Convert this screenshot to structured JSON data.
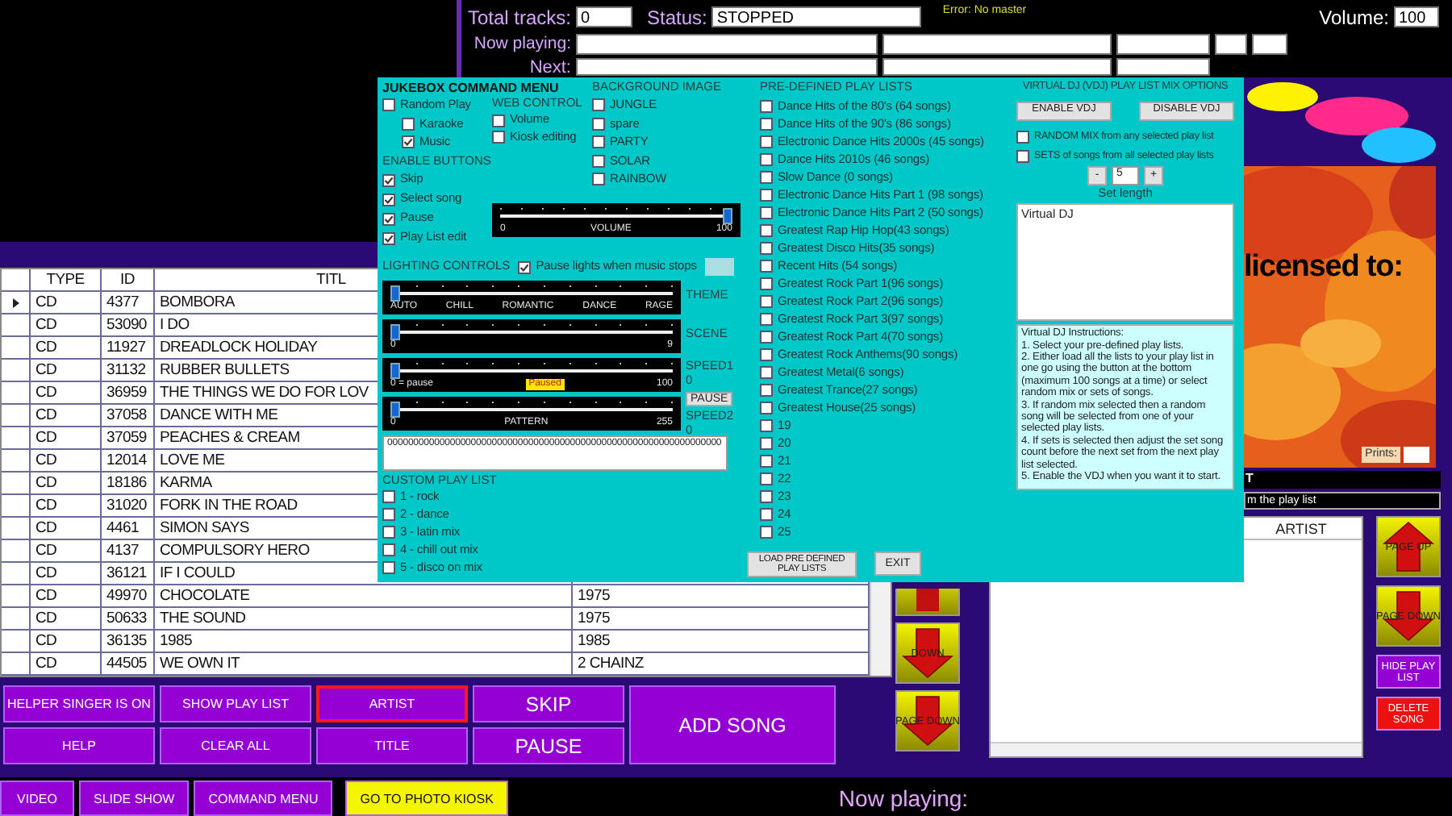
{
  "header": {
    "total_tracks_label": "Total tracks:",
    "total_tracks": "0",
    "status_label": "Status:",
    "status": "STOPPED",
    "error": "Error: No master",
    "volume_label": "Volume:",
    "volume": "100",
    "now_playing_label": "Now playing:",
    "next_label": "Next:"
  },
  "tracks_table": {
    "columns": [
      "TYPE",
      "ID",
      "TITL"
    ],
    "rows": [
      {
        "type": "CD",
        "id": "4377",
        "title": "BOMBORA",
        "selected": true
      },
      {
        "type": "CD",
        "id": "53090",
        "title": "I DO",
        "selected": false
      },
      {
        "type": "CD",
        "id": "11927",
        "title": "DREADLOCK HOLIDAY",
        "selected": false
      },
      {
        "type": "CD",
        "id": "31132",
        "title": "RUBBER BULLETS",
        "selected": false
      },
      {
        "type": "CD",
        "id": "36959",
        "title": "THE THINGS WE DO FOR LOV",
        "selected": false
      },
      {
        "type": "CD",
        "id": "37058",
        "title": "DANCE WITH ME",
        "selected": false
      },
      {
        "type": "CD",
        "id": "37059",
        "title": "PEACHES & CREAM",
        "selected": false
      },
      {
        "type": "CD",
        "id": "12014",
        "title": "LOVE ME",
        "selected": false
      },
      {
        "type": "CD",
        "id": "18186",
        "title": "KARMA",
        "selected": false
      },
      {
        "type": "CD",
        "id": "31020",
        "title": "FORK IN THE ROAD",
        "selected": false
      },
      {
        "type": "CD",
        "id": "4461",
        "title": "SIMON SAYS",
        "selected": false
      },
      {
        "type": "CD",
        "id": "4137",
        "title": "COMPULSORY HERO",
        "selected": false
      },
      {
        "type": "CD",
        "id": "36121",
        "title": "IF I COULD",
        "selected": false
      },
      {
        "type": "CD",
        "id": "49970",
        "title": "CHOCOLATE",
        "column_4": "1975",
        "selected": false
      },
      {
        "type": "CD",
        "id": "50633",
        "title": "THE SOUND",
        "column_4": "1975",
        "selected": false
      },
      {
        "type": "CD",
        "id": "36135",
        "title": "1985",
        "column_4": "1985",
        "selected": false
      },
      {
        "type": "CD",
        "id": "44505",
        "title": "WE OWN IT",
        "column_4": "2 CHAINZ",
        "selected": false
      }
    ]
  },
  "control_buttons": [
    {
      "label": "HELPER SINGER IS ON",
      "kind": "small",
      "selected": false
    },
    {
      "label": "SHOW PLAY LIST",
      "kind": "small",
      "selected": false
    },
    {
      "label": "ARTIST",
      "kind": "small",
      "selected": true
    },
    {
      "label": "SKIP",
      "kind": "large",
      "selected": false
    },
    {
      "label": "ADD SONG",
      "kind": "tall",
      "selected": false
    },
    {
      "label": "HELP",
      "kind": "small",
      "selected": false
    },
    {
      "label": "CLEAR ALL",
      "kind": "small",
      "selected": false
    },
    {
      "label": "TITLE",
      "kind": "small",
      "selected": false
    },
    {
      "label": "PAUSE",
      "kind": "large",
      "selected": false
    }
  ],
  "nav_buttons": [
    {
      "kind": "stub"
    },
    {
      "label": "DOWN",
      "kind": "down"
    },
    {
      "label": "PAGE DOWN",
      "kind": "down"
    }
  ],
  "preview": {
    "caption": "licensed to:",
    "prints_label": "Prints:"
  },
  "playlist_panel": {
    "title": "T",
    "hint": "m the play list",
    "columns": [
      "ARTIST"
    ]
  },
  "playlist_buttons": [
    {
      "label": "PAGE UP",
      "kind": "up"
    },
    {
      "label": "PAGE DOWN",
      "kind": "down"
    },
    {
      "label": "HIDE PLAY LIST",
      "kind": "menu"
    },
    {
      "label": "DELETE SONG",
      "kind": "danger"
    }
  ],
  "bottom_bar": {
    "buttons": [
      {
        "label": "VIDEO",
        "kind": "menu"
      },
      {
        "label": "SLIDE SHOW",
        "kind": "menu"
      },
      {
        "label": "COMMAND MENU",
        "kind": "menu"
      },
      {
        "label": "GO TO  PHOTO KIOSK",
        "kind": "highlight"
      }
    ],
    "now_playing_label": "Now playing:"
  },
  "command_menu": {
    "title": "JUKEBOX COMMAND MENU",
    "play_mode": [
      {
        "label": "Random Play",
        "checked": false,
        "children": [
          {
            "label": "Karaoke",
            "checked": false
          },
          {
            "label": "Music",
            "checked": true
          }
        ]
      }
    ],
    "web_control": {
      "title": "WEB CONTROL",
      "options": [
        {
          "label": "Volume",
          "checked": false
        },
        {
          "label": "Kiosk editing",
          "checked": false
        }
      ]
    },
    "background_image": {
      "title": "BACKGROUND IMAGE",
      "options": [
        {
          "label": "JUNGLE",
          "checked": false
        },
        {
          "label": "spare",
          "checked": false
        },
        {
          "label": "PARTY",
          "checked": false
        },
        {
          "label": "SOLAR",
          "checked": false
        },
        {
          "label": "RAINBOW",
          "checked": false
        }
      ]
    },
    "enable_buttons": {
      "title": "ENABLE BUTTONS",
      "options": [
        {
          "label": "Skip",
          "checked": true
        },
        {
          "label": "Select song",
          "checked": true
        },
        {
          "label": "Pause",
          "checked": true
        },
        {
          "label": "Play List edit",
          "checked": true
        }
      ]
    },
    "volume_slider": {
      "labels": [
        {
          "text": "0",
          "kind": "tick"
        },
        {
          "text": "VOLUME",
          "kind": "tick"
        },
        {
          "text": "100",
          "kind": "tick"
        }
      ],
      "level": 1
    },
    "lighting": {
      "title": "LIGHTING CONTROLS",
      "pause_lights": {
        "label": "Pause lights when music stops",
        "checked": true
      },
      "sliders": [
        {
          "name": "THEME",
          "labels": [
            {
              "text": "AUTO",
              "kind": "tick"
            },
            {
              "text": "CHILL",
              "kind": "tick"
            },
            {
              "text": "ROMANTIC",
              "kind": "tick"
            },
            {
              "text": "DANCE",
              "kind": "tick"
            },
            {
              "text": "RAGE",
              "kind": "tick"
            }
          ],
          "level": 0
        },
        {
          "name": "SCENE",
          "labels": [
            {
              "text": "0",
              "kind": "tick"
            },
            {
              "text": "9",
              "kind": "tick"
            }
          ],
          "level": 0
        },
        {
          "name": "SPEED1",
          "value": "0",
          "button": "PAUSE",
          "labels": [
            {
              "text": "0 = pause",
              "kind": "tick"
            },
            {
              "text": "Paused",
              "kind": "badge"
            },
            {
              "text": "100",
              "kind": "tick"
            }
          ],
          "level": 0
        },
        {
          "name": "SPEED2",
          "value": "0",
          "labels": [
            {
              "text": "0",
              "kind": "tick"
            },
            {
              "text": "PATTERN",
              "kind": "tick"
            },
            {
              "text": "255",
              "kind": "tick"
            }
          ],
          "level": 0
        }
      ],
      "pattern": "0000000000000000000000000000000000000000000000000000000000000000"
    },
    "custom_play_list": {
      "title": "CUSTOM PLAY LIST",
      "options": [
        {
          "label": "1 - rock",
          "checked": false
        },
        {
          "label": "2 - dance",
          "checked": false
        },
        {
          "label": "3 - latin mix",
          "checked": false
        },
        {
          "label": "4 - chill out mix",
          "checked": false
        },
        {
          "label": "5 - disco on mix",
          "checked": false
        }
      ]
    },
    "predefined": {
      "title": "PRE-DEFINED PLAY LISTS",
      "options": [
        {
          "label": "Dance Hits of the 80's (64 songs)",
          "checked": false
        },
        {
          "label": "Dance Hits of the 90's (86 songs)",
          "checked": false
        },
        {
          "label": "Electronic Dance Hits 2000s (45 songs)",
          "checked": false
        },
        {
          "label": "Dance Hits 2010s (46 songs)",
          "checked": false
        },
        {
          "label": "Slow Dance (0 songs)",
          "checked": false
        },
        {
          "label": "Electronic Dance Hits Part 1 (98 songs)",
          "checked": false
        },
        {
          "label": "Electronic Dance Hits Part 2 (50 songs)",
          "checked": false
        },
        {
          "label": "Greatest Rap Hip Hop(43 songs)",
          "checked": false
        },
        {
          "label": "Greatest Disco Hits(35 songs)",
          "checked": false
        },
        {
          "label": "Recent Hits (54 songs)",
          "checked": false
        },
        {
          "label": "Greatest Rock Part 1(96 songs)",
          "checked": false
        },
        {
          "label": "Greatest Rock Part 2(96 songs)",
          "checked": false
        },
        {
          "label": "Greatest Rock Part 3(97 songs)",
          "checked": false
        },
        {
          "label": "Greatest Rock Part 4(70 songs)",
          "checked": false
        },
        {
          "label": "Greatest Rock Anthems(90 songs)",
          "checked": false
        },
        {
          "label": "Greatest Metal(6 songs)",
          "checked": false
        },
        {
          "label": "Greatest Trance(27 songs)",
          "checked": false
        },
        {
          "label": "Greatest House(25 songs)",
          "checked": false
        },
        {
          "label": "19",
          "checked": false
        },
        {
          "label": "20",
          "checked": false
        },
        {
          "label": "21",
          "checked": false
        },
        {
          "label": "22",
          "checked": false
        },
        {
          "label": "23",
          "checked": false
        },
        {
          "label": "24",
          "checked": false
        },
        {
          "label": "25",
          "checked": false
        }
      ],
      "load_button": "LOAD PRE DEFINED PLAY LISTS",
      "exit_button": "EXIT"
    },
    "vdj": {
      "title": "VIRTUAL DJ (VDJ) PLAY LIST MIX OPTIONS",
      "enable_button": "ENABLE VDJ",
      "disable_button": "DISABLE VDJ",
      "options": [
        {
          "label": "RANDOM MIX from any selected play list",
          "checked": false
        },
        {
          "label": "SETS of songs from all selected play lists",
          "checked": false
        }
      ],
      "decrement": "-",
      "set_length": "5",
      "increment": "+",
      "set_length_label": "Set length",
      "log": "Virtual DJ",
      "instructions_title": "Virtual DJ Instructions:",
      "instructions": [
        "1. Select your pre-defined play lists.",
        "2. Either load all the lists to your play list in one go using the button at the bottom (maximum 100 songs at a time) or select random mix or sets of songs.",
        "3. If random mix selected then a random song will be selected from one of your selected play lists.",
        "4. If sets is selected then adjust the set song count before the next set from the next play list selected.",
        "5. Enable the VDJ when you want it to start."
      ]
    }
  }
}
